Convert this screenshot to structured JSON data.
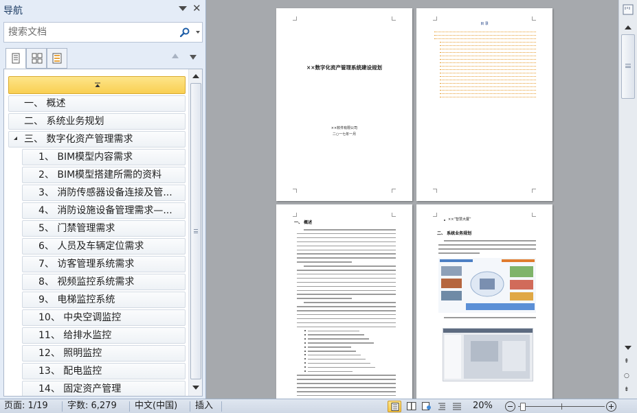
{
  "nav": {
    "title": "导航",
    "search_placeholder": "搜索文档",
    "outline": [
      {
        "label": "一、 概述",
        "level": 1
      },
      {
        "label": "二、 系统业务规划",
        "level": 1
      },
      {
        "label": "三、 数字化资产管理需求",
        "level": 1
      },
      {
        "label": "1、 BIM模型内容需求",
        "level": 2
      },
      {
        "label": "2、 BIM模型搭建所需的资料",
        "level": 2
      },
      {
        "label": "3、 消防传感器设备连接及管...",
        "level": 2
      },
      {
        "label": "4、 消防设施设备管理需求—...",
        "level": 2
      },
      {
        "label": "5、 门禁管理需求",
        "level": 2
      },
      {
        "label": "6、 人员及车辆定位需求",
        "level": 2
      },
      {
        "label": "7、 访客管理系统需求",
        "level": 2
      },
      {
        "label": "8、 视频监控系统需求",
        "level": 2
      },
      {
        "label": "9、 电梯监控系统",
        "level": 2
      },
      {
        "label": "10、 中央空调监控",
        "level": 2
      },
      {
        "label": "11、 给排水监控",
        "level": 2
      },
      {
        "label": "12、 照明监控",
        "level": 2
      },
      {
        "label": "13、 配电监控",
        "level": 2
      },
      {
        "label": "14、 固定资产管理",
        "level": 2
      }
    ]
  },
  "pages": {
    "p1": {
      "title": "××数字化资产管理系统建设规划",
      "company": "××软件有限公司",
      "date": "二○一七年一月"
    },
    "p2": {
      "toc_title": "目  录"
    },
    "p3": {
      "heading": "一、 概述"
    },
    "p4": {
      "bullet_text": "××“智慧大厦”",
      "heading": "二、 系统业务规划"
    }
  },
  "status": {
    "page": "页面: 1/19",
    "words": "字数: 6,279",
    "language": "中文(中国)",
    "mode": "插入",
    "zoom": "20%",
    "zoom_percent": 20
  }
}
